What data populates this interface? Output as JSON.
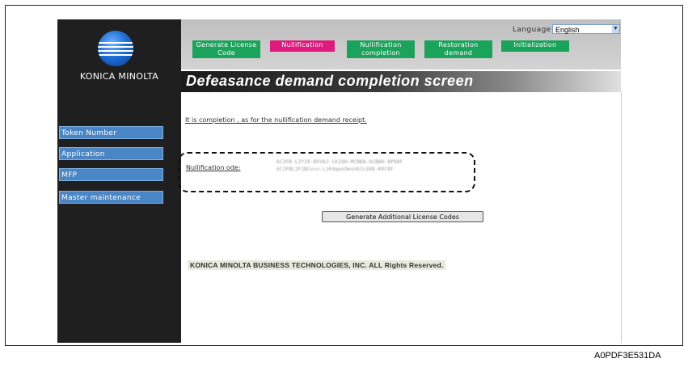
{
  "language": {
    "label": "Language",
    "selected": "English"
  },
  "logo": {
    "text": "KONICA MINOLTA"
  },
  "tabs": [
    {
      "line1": "Generate License",
      "line2": "Code",
      "color": "#1aa35a"
    },
    {
      "line1": "Nullification",
      "line2": "",
      "color": "#e0197d"
    },
    {
      "line1": "Nullification",
      "line2": "completion",
      "color": "#1aa35a"
    },
    {
      "line1": "Restoration",
      "line2": "demand",
      "color": "#1aa35a"
    },
    {
      "line1": "Initialization",
      "line2": "",
      "color": "#1aa35a"
    }
  ],
  "sidebar": {
    "items": [
      "Token Number",
      "Application",
      "MFP",
      "Master maintenance"
    ]
  },
  "page_title": "Defeasance demand completion screen",
  "message": "It is completion , as for the nullification demand receipt.",
  "nullification": {
    "label": "Nullification ode:",
    "code_line1": "6C2FB-LZYIR-BVVAJ-LKIQH-MCNB8-DCBBH-8P88F",
    "code_line2": "6C2FBL2F2BCvvv-LzKdqwsOmsnb1Ldd8-KRC8F"
  },
  "generate_button": "Generate Additional License Codes",
  "copyright": "KONICA MINOLTA BUSINESS TECHNOLOGIES, INC.  ALL Rights Reserved.",
  "figure_id": "A0PDF3E531DA"
}
